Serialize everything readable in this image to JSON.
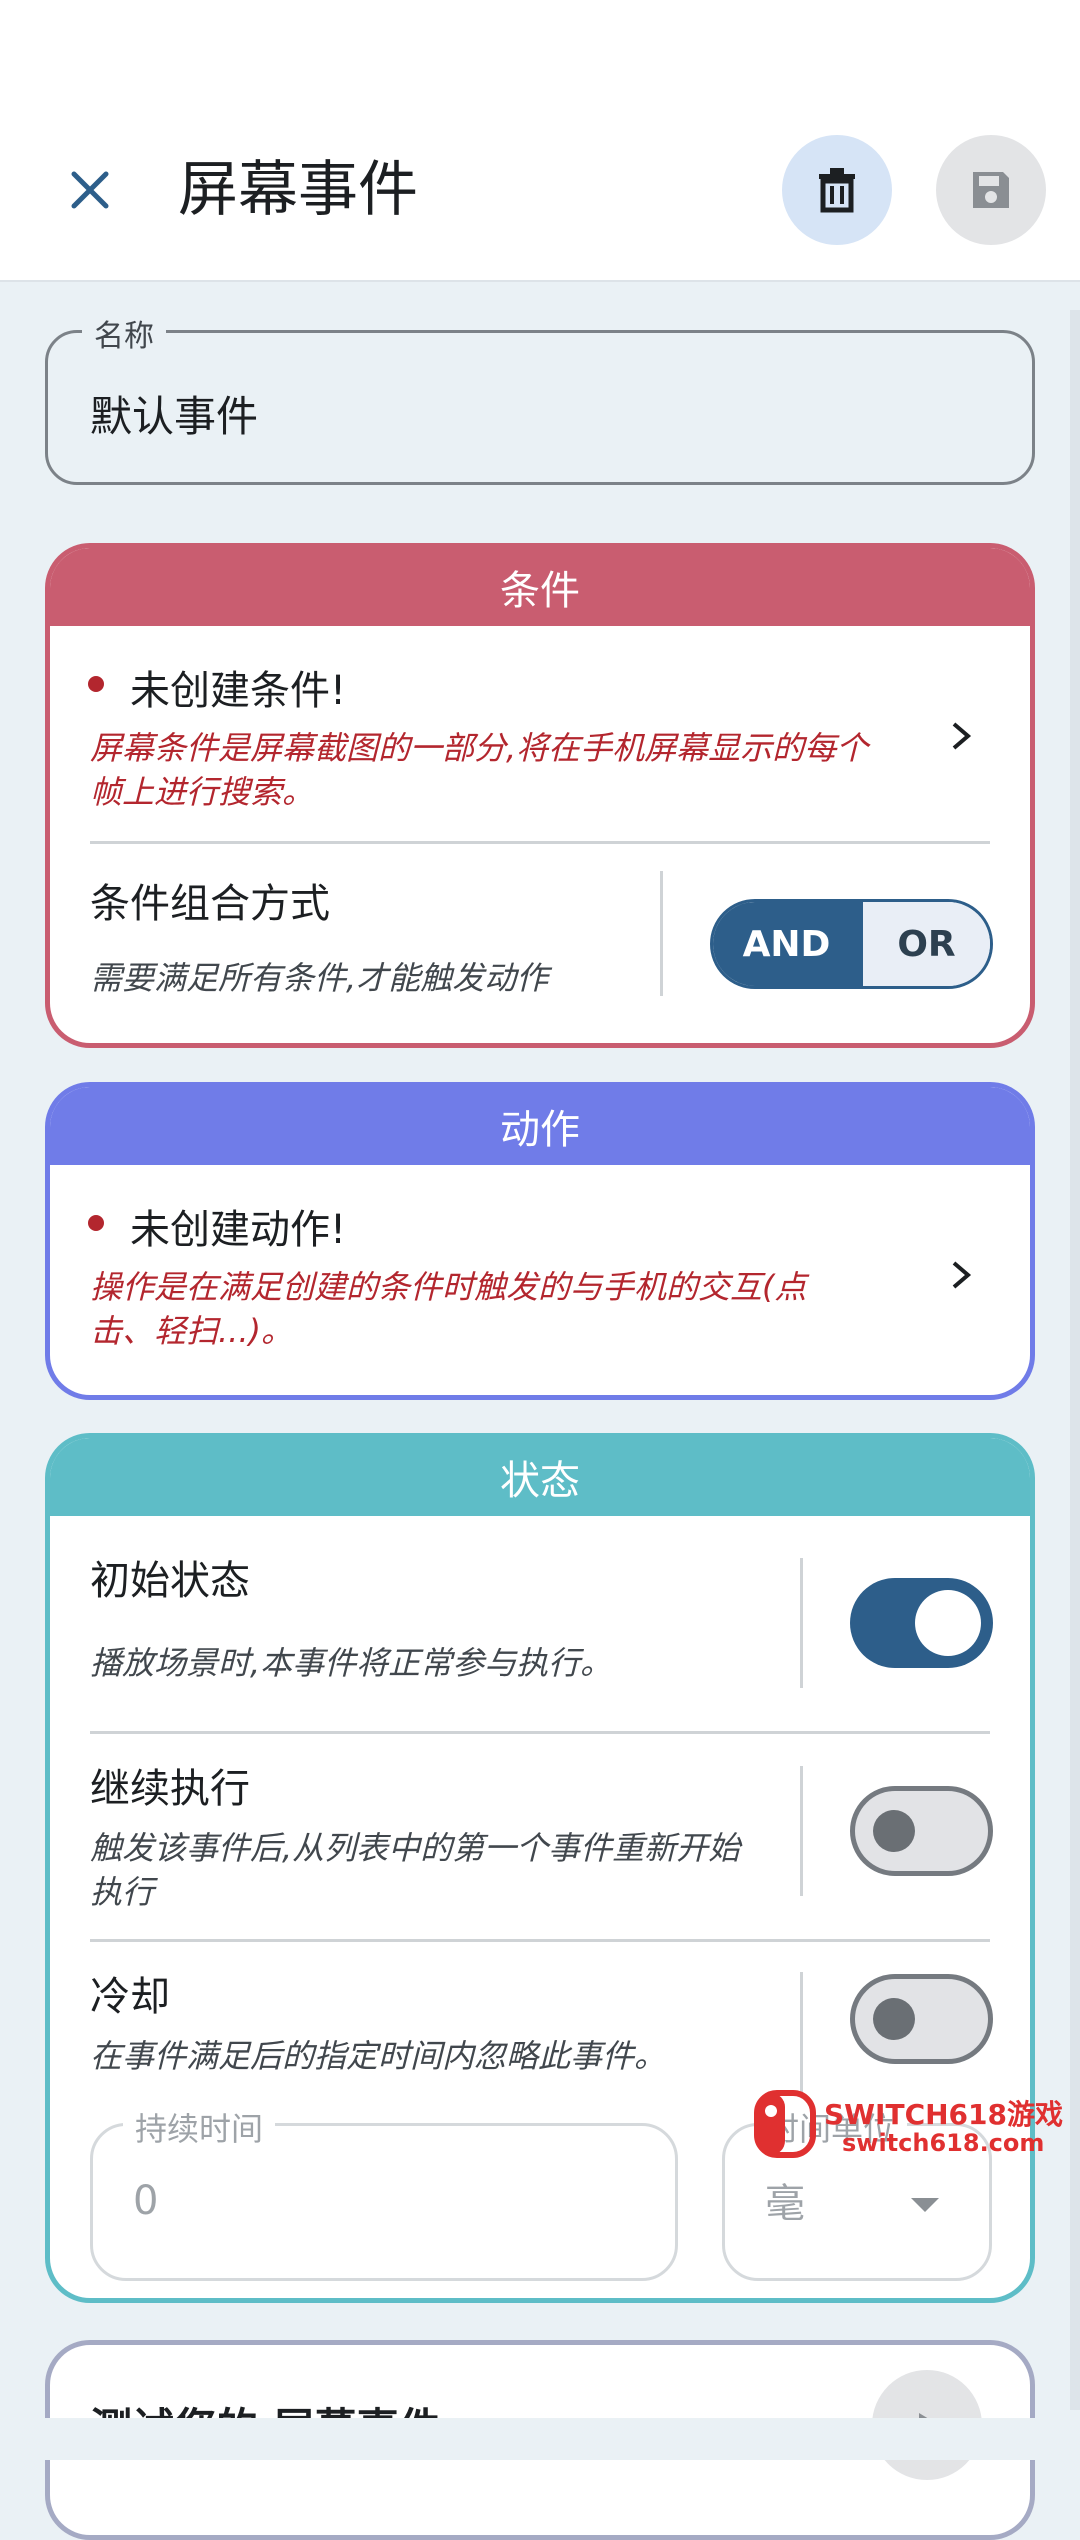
{
  "header": {
    "title": "屏幕事件",
    "icons": {
      "close": "close-icon",
      "delete": "trash-icon",
      "save": "save-icon"
    }
  },
  "name_field": {
    "label": "名称",
    "value": "默认事件"
  },
  "conditions": {
    "header": "条件",
    "warning_title": "未创建条件!",
    "warning_desc": "屏幕条件是屏幕截图的一部分,将在手机屏幕显示的每个帧上进行搜索。",
    "operator_title": "条件组合方式",
    "operator_desc": "需要满足所有条件,才能触发动作",
    "and_label": "AND",
    "or_label": "OR",
    "selected": "AND"
  },
  "actions": {
    "header": "动作",
    "warning_title": "未创建动作!",
    "warning_desc": "操作是在满足创建的条件时触发的与手机的交互(点击、轻扫...)。"
  },
  "state": {
    "header": "状态",
    "initial_title": "初始状态",
    "initial_desc": "播放场景时,本事件将正常参与执行。",
    "initial_on": true,
    "continue_title": "继续执行",
    "continue_desc": "触发该事件后,从列表中的第一个事件重新开始执行",
    "continue_on": false,
    "cooldown_title": "冷却",
    "cooldown_desc": "在事件满足后的指定时间内忽略此事件。",
    "cooldown_on": false,
    "duration_label": "持续时间",
    "duration_value": "0",
    "unit_label": "时间单位",
    "unit_value": "毫"
  },
  "test": {
    "title": "测试您的 屏幕事件"
  },
  "watermark": {
    "line1": "SWITCH618游戏",
    "line2": "switch618.com"
  },
  "colors": {
    "conditions_accent": "#c95d70",
    "actions_accent": "#707ce8",
    "state_accent": "#5ebdc7",
    "primary": "#2d5e8a",
    "error": "#b3262e"
  }
}
